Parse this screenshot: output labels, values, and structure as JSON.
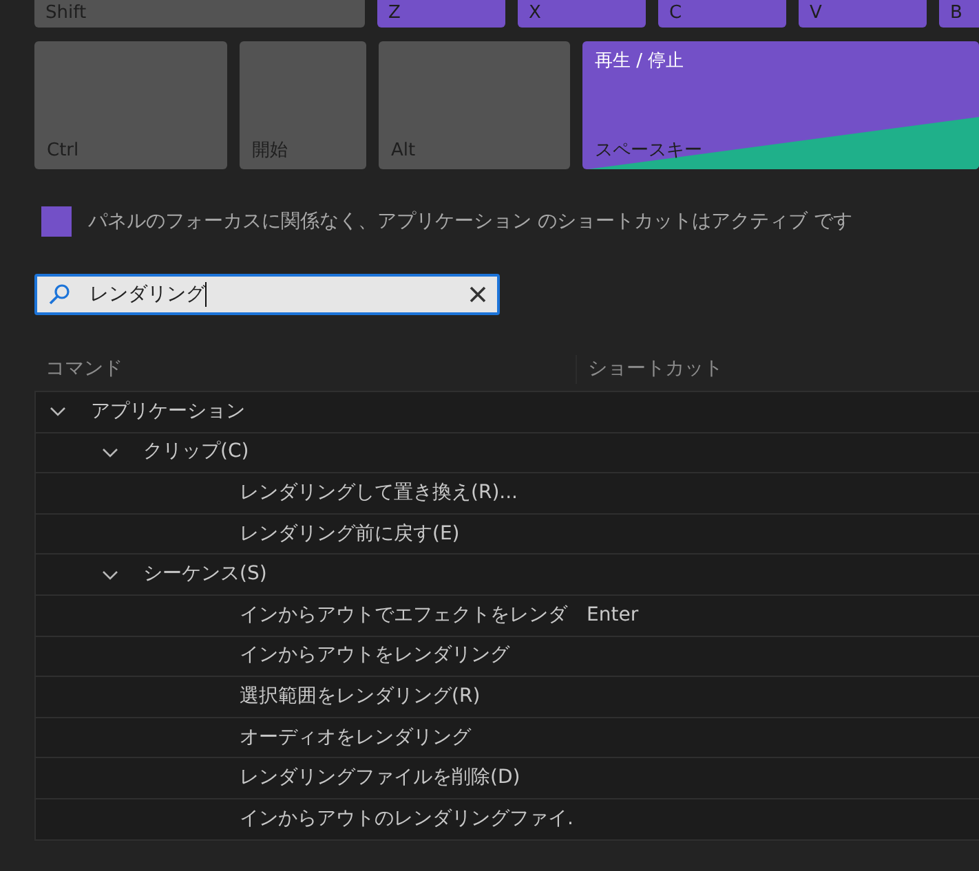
{
  "keyboard": {
    "upper_keys": [
      {
        "kind": "modifier",
        "key": "Shift"
      },
      {
        "kind": "assigned",
        "key": "Z"
      },
      {
        "kind": "assigned",
        "key": "X"
      },
      {
        "kind": "assigned",
        "key": "C"
      },
      {
        "kind": "assigned",
        "key": "V"
      },
      {
        "kind": "assigned",
        "key": "B"
      }
    ],
    "lower_keys": [
      {
        "kind": "modifier",
        "key": "Ctrl"
      },
      {
        "kind": "modifier",
        "key": "開始"
      },
      {
        "kind": "modifier",
        "key": "Alt"
      },
      {
        "kind": "assigned",
        "key": "スペースキー",
        "command": "再生 / 停止"
      }
    ]
  },
  "app_shortcuts_option": {
    "label": "パネルのフォーカスに関係なく、アプリケーション のショートカットはアクティブ です",
    "checked": true
  },
  "search": {
    "value": "レンダリング"
  },
  "table": {
    "columns": [
      "コマンド",
      "ショートカット"
    ],
    "tree": [
      {
        "label": "アプリケーション",
        "expanded": true,
        "children": [
          {
            "label": "クリップ(C)",
            "expanded": true,
            "children": [
              {
                "label": "レンダリングして置き換え(R)..."
              },
              {
                "label": "レンダリング前に戻す(E)"
              }
            ]
          },
          {
            "label": "シーケンス(S)",
            "expanded": true,
            "children": [
              {
                "label": "インからアウトでエフェクトをレンダ",
                "shortcut": "Enter"
              },
              {
                "label": "インからアウトをレンダリング"
              },
              {
                "label": "選択範囲をレンダリング(R)"
              },
              {
                "label": "オーディオをレンダリング"
              },
              {
                "label": "レンダリングファイルを削除(D)"
              },
              {
                "label": "インからアウトのレンダリングファイ."
              }
            ]
          }
        ]
      }
    ]
  }
}
